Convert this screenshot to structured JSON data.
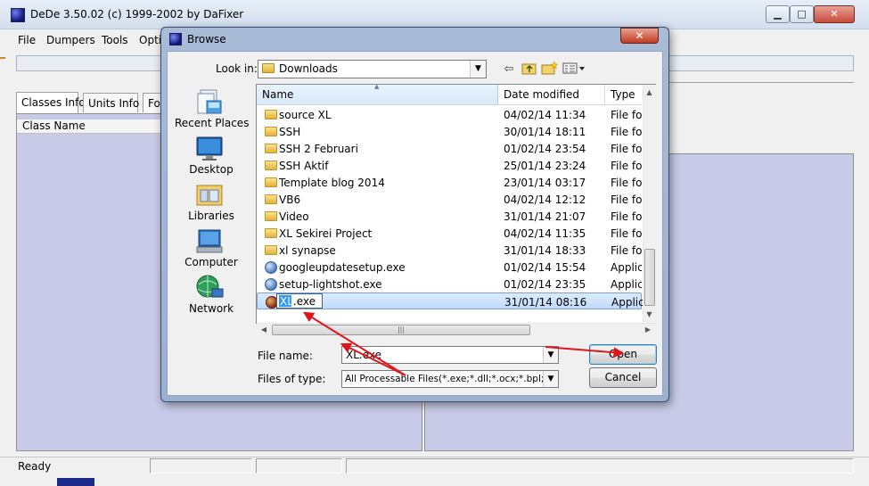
{
  "main_window": {
    "title": "DeDe 3.50.02 (c) 1999-2002 by DaFixer",
    "menu": [
      "File",
      "Dumpers",
      "Tools",
      "Opti"
    ],
    "tabs": [
      "Classes Info",
      "Units Info",
      "Fo"
    ],
    "class_name_header": "Class Name",
    "status": "Ready",
    "caption_buttons": {
      "minimize": "▁",
      "maximize": "□",
      "close": "✕"
    }
  },
  "dialog": {
    "title": "Browse",
    "close_glyph": "✕",
    "look_in_label": "Look in:",
    "look_in_value": "Downloads",
    "places": [
      "Recent Places",
      "Desktop",
      "Libraries",
      "Computer",
      "Network"
    ],
    "columns": {
      "name": "Name",
      "date": "Date modified",
      "type": "Type"
    },
    "files": [
      {
        "name": "source XL",
        "date": "04/02/14 11:34",
        "type": "File fol",
        "kind": "folder"
      },
      {
        "name": "SSH",
        "date": "30/01/14 18:11",
        "type": "File fol",
        "kind": "folder"
      },
      {
        "name": "SSH 2 Februari",
        "date": "01/02/14 23:54",
        "type": "File fol",
        "kind": "folder"
      },
      {
        "name": "SSH Aktif",
        "date": "25/01/14 23:24",
        "type": "File fol",
        "kind": "folder"
      },
      {
        "name": "Template blog 2014",
        "date": "23/01/14 03:17",
        "type": "File fol",
        "kind": "folder"
      },
      {
        "name": "VB6",
        "date": "04/02/14 12:12",
        "type": "File fol",
        "kind": "folder"
      },
      {
        "name": "Video",
        "date": "31/01/14 21:07",
        "type": "File fol",
        "kind": "folder"
      },
      {
        "name": "XL Sekirei Project",
        "date": "04/02/14 11:35",
        "type": "File fol",
        "kind": "folder"
      },
      {
        "name": "xl synapse",
        "date": "31/01/14 18:33",
        "type": "File fol",
        "kind": "folder"
      },
      {
        "name": "googleupdatesetup.exe",
        "date": "01/02/14 15:54",
        "type": "Applic",
        "kind": "app"
      },
      {
        "name": "setup-lightshot.exe",
        "date": "01/02/14 23:35",
        "type": "Applic",
        "kind": "app"
      },
      {
        "name": "XL.exe",
        "date": "31/01/14 08:16",
        "type": "Applic",
        "kind": "app"
      }
    ],
    "rename_selected": "XL",
    "rename_rest": ".exe",
    "file_name_label": "File name:",
    "file_name_value": "XL.exe",
    "files_of_type_label": "Files of type:",
    "files_of_type_value": "All Processable Files(*.exe;*.dll;*.ocx;*.bpl;*.dcp",
    "open_label": "Open",
    "cancel_label": "Cancel"
  },
  "colors": {
    "annotation_arrow": "#e0151b",
    "panel_bg": "#c8cbe8",
    "selection": "#c1dbfc"
  }
}
